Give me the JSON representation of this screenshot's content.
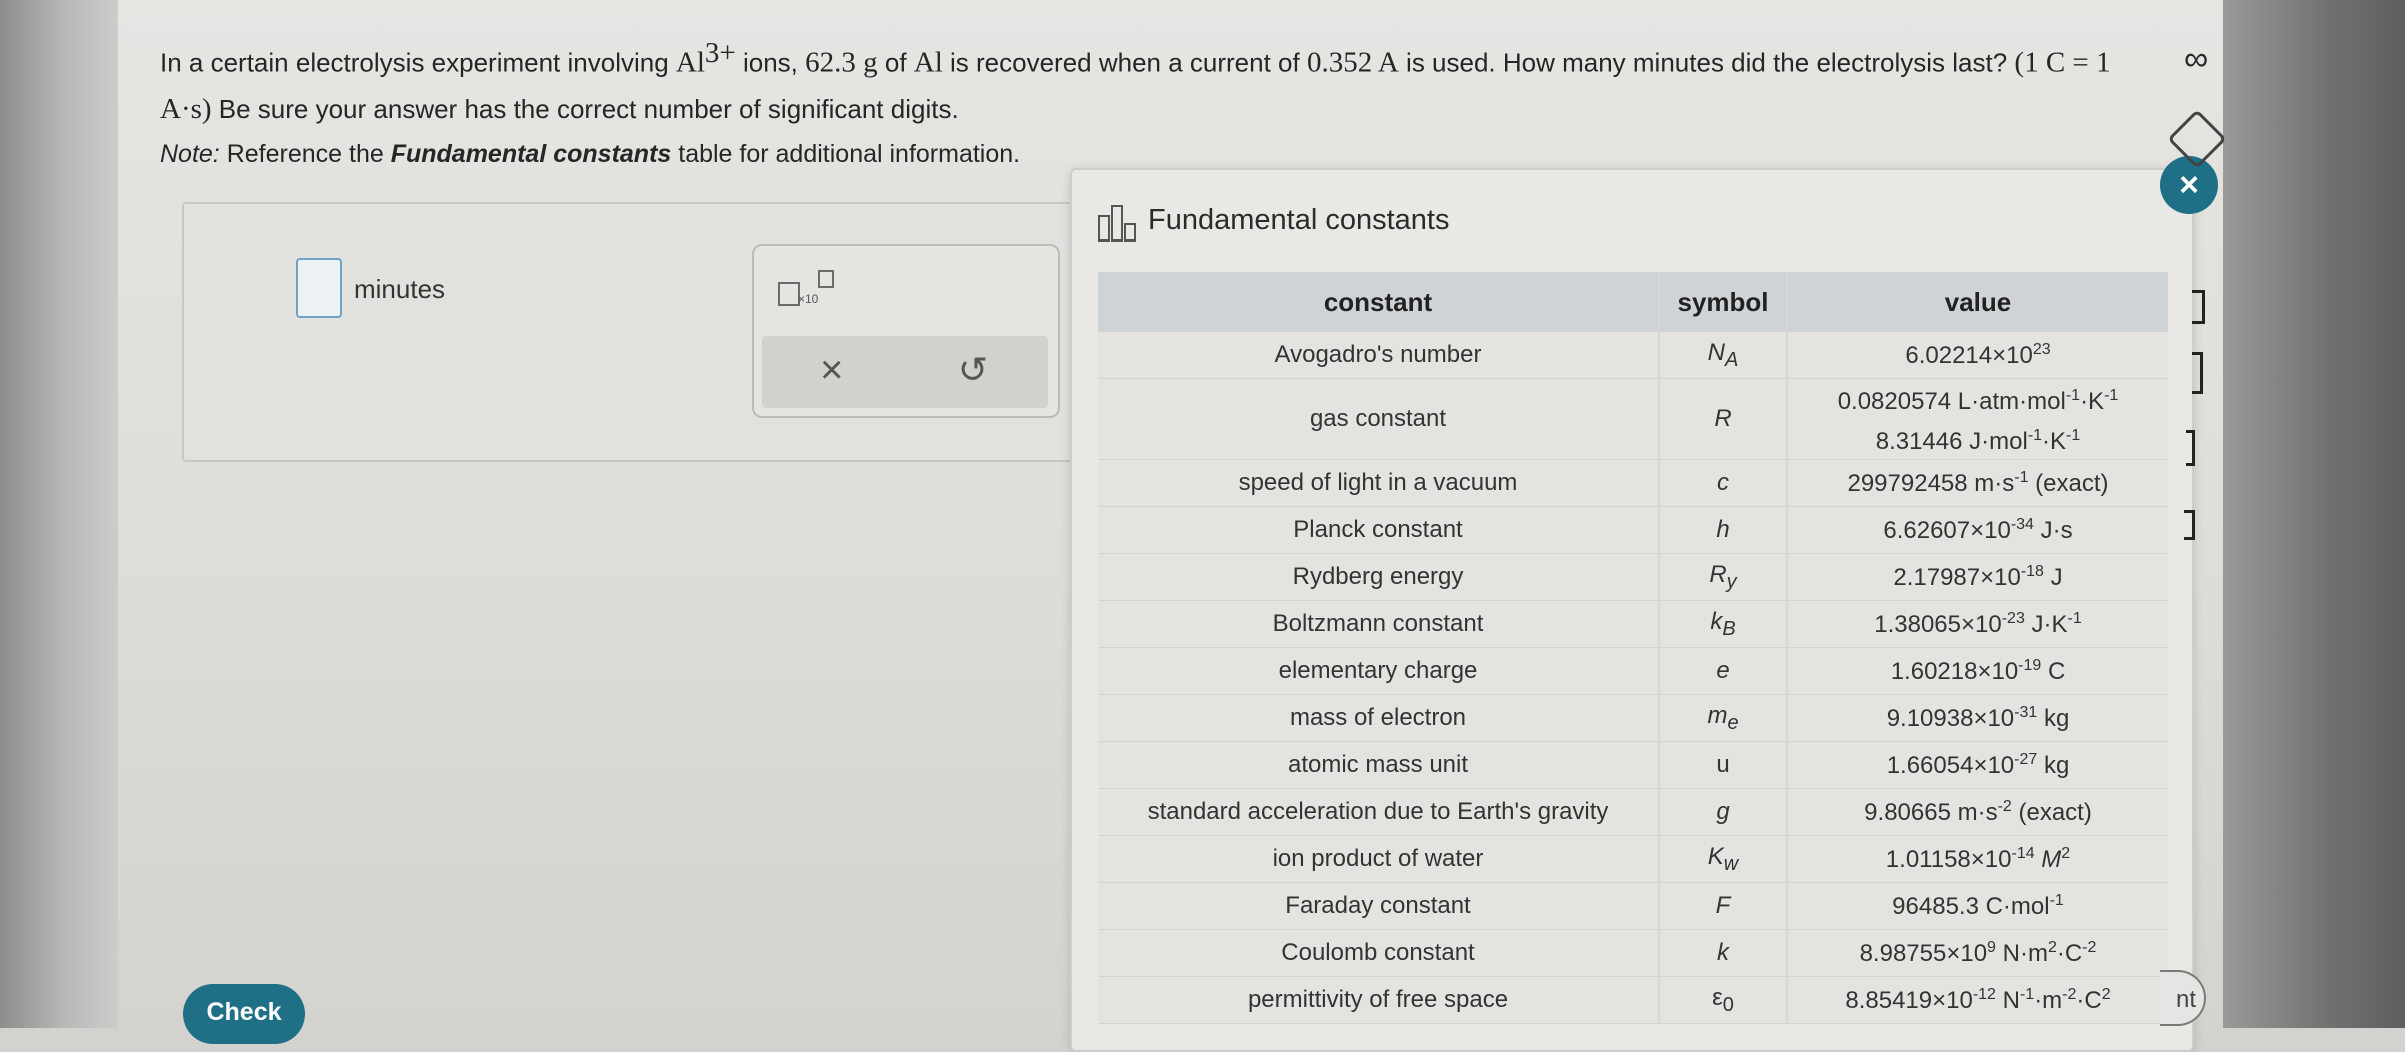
{
  "question": {
    "part1": "In a certain electrolysis experiment involving ",
    "ion": "Al",
    "ion_charge": "3+",
    "part2": " ions, ",
    "mass": "62.3 g",
    "part3": " of ",
    "element": "Al",
    "part4": " is recovered when a current of ",
    "current": "0.352 A",
    "part5": " is used. How many minutes did the electrolysis last? ",
    "unit_def": "(1 C = 1 A·s)",
    "part6": " Be sure your answer has the correct number of significant digits."
  },
  "note": {
    "prefix": "Note:",
    "middle": " Reference the ",
    "table_name": "Fundamental constants",
    "suffix": " table for additional information."
  },
  "answer": {
    "value": "",
    "unit": "minutes"
  },
  "tools": {
    "sci_notation": "×10",
    "clear": "×",
    "undo": "↺"
  },
  "check_label": "Check",
  "modal": {
    "title": "Fundamental constants",
    "close": "×",
    "headers": [
      "constant",
      "symbol",
      "value"
    ]
  },
  "constants": [
    {
      "name": "Avogadro's number",
      "symbol": "N",
      "symbol_sub": "A",
      "value": "6.02214×10",
      "exp": "23",
      "after": ""
    },
    {
      "name": "gas constant",
      "symbol": "R",
      "symbol_sub": "",
      "value": "0.0820574 L·atm·mol",
      "exp": "-1",
      "after": "·K",
      "exp2": "-1",
      "value2": "8.31446 J·mol",
      "exp3": "-1",
      "after2": "·K",
      "exp4": "-1"
    },
    {
      "name": "speed of light in a vacuum",
      "symbol": "c",
      "symbol_sub": "",
      "value": "299792458 m·s",
      "exp": "-1",
      "after": " (exact)"
    },
    {
      "name": "Planck constant",
      "symbol": "h",
      "symbol_sub": "",
      "value": "6.62607×10",
      "exp": "-34",
      "after": " J·s"
    },
    {
      "name": "Rydberg energy",
      "symbol": "R",
      "symbol_sub": "y",
      "value": "2.17987×10",
      "exp": "-18",
      "after": " J"
    },
    {
      "name": "Boltzmann constant",
      "symbol": "k",
      "symbol_sub": "B",
      "value": "1.38065×10",
      "exp": "-23",
      "after": " J·K",
      "exp2": "-1"
    },
    {
      "name": "elementary charge",
      "symbol": "e",
      "symbol_sub": "",
      "value": "1.60218×10",
      "exp": "-19",
      "after": " C"
    },
    {
      "name": "mass of electron",
      "symbol": "m",
      "symbol_sub": "e",
      "value": "9.10938×10",
      "exp": "-31",
      "after": " kg"
    },
    {
      "name": "atomic mass unit",
      "symbol": "u",
      "symbol_sub": "",
      "value": "1.66054×10",
      "exp": "-27",
      "after": " kg"
    },
    {
      "name": "standard acceleration due to Earth's gravity",
      "symbol": "g",
      "symbol_sub": "",
      "value": "9.80665 m·s",
      "exp": "-2",
      "after": " (exact)"
    },
    {
      "name": "ion product of water",
      "symbol": "K",
      "symbol_sub": "w",
      "value": "1.01158×10",
      "exp": "-14",
      "after": " M",
      "exp2": "2"
    },
    {
      "name": "Faraday constant",
      "symbol": "F",
      "symbol_sub": "",
      "value": "96485.3 C·mol",
      "exp": "-1",
      "after": ""
    },
    {
      "name": "Coulomb constant",
      "symbol": "k",
      "symbol_sub": "",
      "value": "8.98755×10",
      "exp": "9",
      "after": " N·m",
      "exp2": "2",
      "after_b": "·C",
      "exp3": "-2"
    },
    {
      "name": "permittivity of free space",
      "symbol": "ε",
      "symbol_sub": "0",
      "value": "8.85419×10",
      "exp": "-12",
      "after": " N",
      "exp2": "-1",
      "after_b": "·m",
      "exp3": "-2",
      "after_c": "·C",
      "exp4": "2"
    }
  ],
  "side": {
    "infinity": "∞",
    "right_button": "nt"
  },
  "colors": {
    "accent": "#1f6f86",
    "input_border": "#6aa5c9"
  }
}
